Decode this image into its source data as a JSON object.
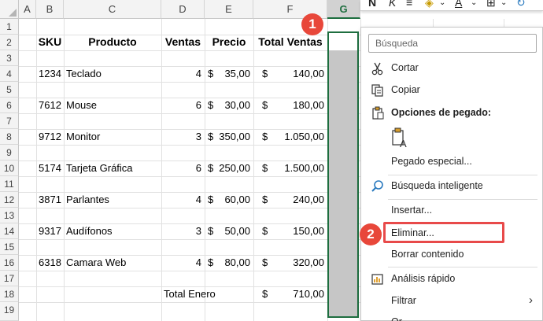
{
  "columns": [
    "A",
    "B",
    "C",
    "D",
    "E",
    "F",
    "G"
  ],
  "rows": [
    "1",
    "2",
    "3",
    "4",
    "5",
    "6",
    "7",
    "8",
    "9",
    "10",
    "11",
    "12",
    "13",
    "14",
    "15",
    "16",
    "17",
    "18",
    "19"
  ],
  "headers": {
    "sku": "SKU",
    "producto": "Producto",
    "ventas": "Ventas",
    "precio": "Precio",
    "total": "Total Ventas"
  },
  "data_rows": [
    {
      "row": "4",
      "sku": "1234",
      "producto": "Teclado",
      "ventas": "4",
      "precio": "35,00",
      "total": "140,00"
    },
    {
      "row": "6",
      "sku": "7612",
      "producto": "Mouse",
      "ventas": "6",
      "precio": "30,00",
      "total": "180,00"
    },
    {
      "row": "8",
      "sku": "9712",
      "producto": "Monitor",
      "ventas": "3",
      "precio": "350,00",
      "total": "1.050,00"
    },
    {
      "row": "10",
      "sku": "5174",
      "producto": "Tarjeta Gráfica",
      "ventas": "6",
      "precio": "250,00",
      "total": "1.500,00"
    },
    {
      "row": "12",
      "sku": "3871",
      "producto": "Parlantes",
      "ventas": "4",
      "precio": "60,00",
      "total": "240,00"
    },
    {
      "row": "14",
      "sku": "9317",
      "producto": "Audífonos",
      "ventas": "3",
      "precio": "50,00",
      "total": "150,00"
    },
    {
      "row": "16",
      "sku": "6318",
      "producto": "Camara Web",
      "ventas": "4",
      "precio": "80,00",
      "total": "320,00"
    }
  ],
  "currency_symbol": "$",
  "total_row": {
    "label": "Total Enero",
    "value": "710,00"
  },
  "selected_column": "G",
  "mini_toolbar": {
    "bold": "N",
    "italic": "K"
  },
  "context_menu": {
    "search_placeholder": "Búsqueda",
    "cut": "Cortar",
    "copy": "Copiar",
    "paste_options": "Opciones de pegado:",
    "paste_special": "Pegado especial...",
    "smart_lookup": "Búsqueda inteligente",
    "insert": "Insertar...",
    "delete": "Eliminar...",
    "clear_contents": "Borrar contenido",
    "quick_analysis": "Análisis rápido",
    "filter": "Filtrar",
    "sort_partial": "Or"
  },
  "callouts": [
    "1",
    "2"
  ],
  "colors": {
    "selection_green": "#1e6e3f",
    "callout_red": "#e8473a",
    "selected_fill": "#c6c6c6"
  }
}
